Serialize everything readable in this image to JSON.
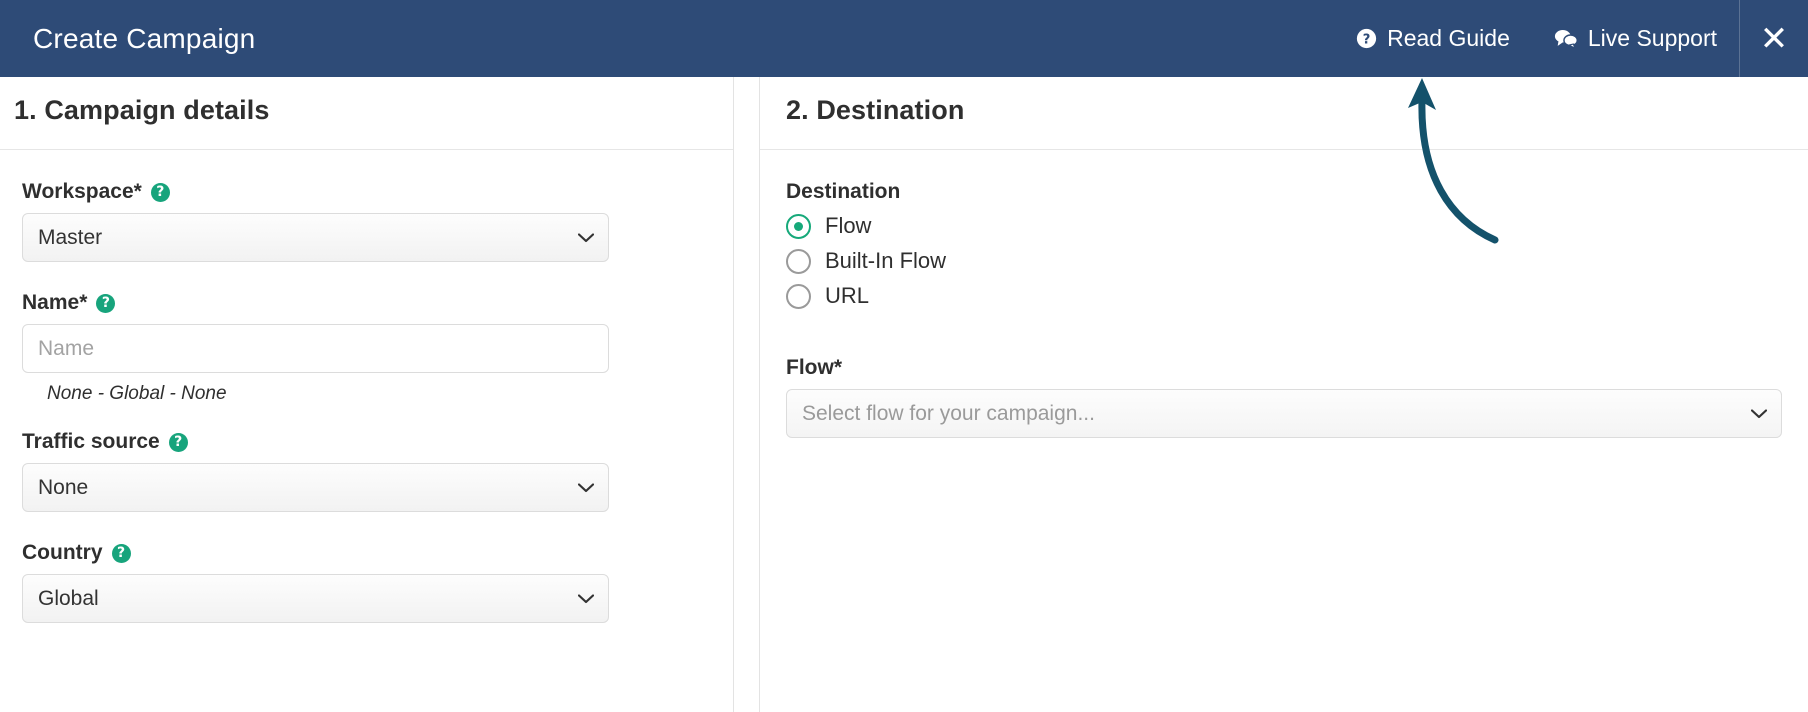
{
  "header": {
    "title": "Create Campaign",
    "read_guide_label": "Read Guide",
    "read_guide_icon": "question-circle-icon",
    "live_support_label": "Live Support",
    "live_support_icon": "chat-bubbles-icon",
    "close_label": "✕",
    "background_color": "#2e4b77",
    "text_color": "#ffffff"
  },
  "left_panel": {
    "section_title": "1. Campaign details",
    "fields": {
      "workspace": {
        "label": "Workspace*",
        "help_icon": "question-mark-help-icon",
        "value": "Master",
        "chevron": "chevron-down-icon"
      },
      "name": {
        "label": "Name*",
        "help_icon": "question-mark-help-icon",
        "value": "",
        "placeholder": "Name",
        "helper_text": "None - Global - None"
      },
      "traffic_source": {
        "label": "Traffic source",
        "help_icon": "question-mark-help-icon",
        "value": "None",
        "chevron": "chevron-down-icon"
      },
      "country": {
        "label": "Country",
        "help_icon": "question-mark-help-icon",
        "value": "Global",
        "chevron": "chevron-down-icon"
      }
    }
  },
  "right_panel": {
    "section_title": "2. Destination",
    "destination": {
      "group_label": "Destination",
      "options": [
        {
          "label": "Flow",
          "selected": true
        },
        {
          "label": "Built-In Flow",
          "selected": false
        },
        {
          "label": "URL",
          "selected": false
        }
      ]
    },
    "flow": {
      "label": "Flow*",
      "value": "",
      "placeholder": "Select flow for your campaign...",
      "chevron": "chevron-down-icon"
    }
  },
  "annotation": {
    "arrow_color": "#14526b",
    "arrow_target": "live-support-link"
  },
  "colors": {
    "accent_green": "#17a47c",
    "radio_selected": "#16a97a",
    "header_blue": "#2e4b77",
    "border_gray": "#dcdcdc",
    "placeholder_gray": "#a3a3a3"
  }
}
